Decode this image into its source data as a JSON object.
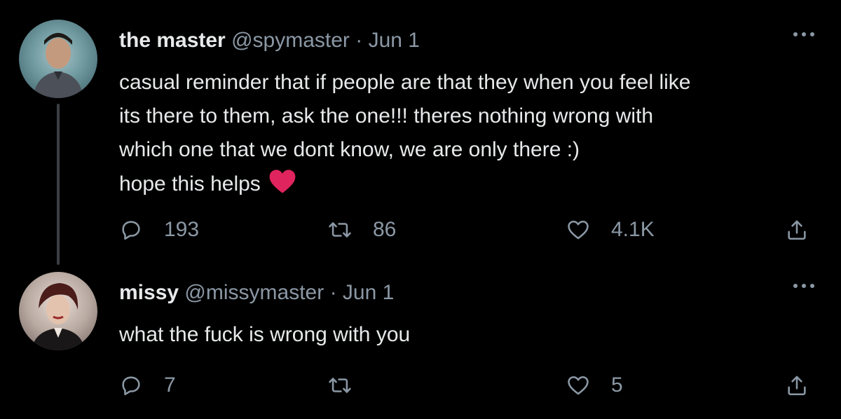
{
  "tweets": [
    {
      "display_name": "the master",
      "handle": "@spymaster",
      "separator": "·",
      "date": "Jun 1",
      "body_lines": [
        "casual reminder that if people are that they when you feel like",
        "its there to them, ask the one!!! theres nothing wrong with",
        "which one that we dont know, we are only there :)",
        "hope this helps"
      ],
      "emoji": "heart-emoji",
      "reply_count": "193",
      "retweet_count": "86",
      "like_count": "4.1K",
      "reply_icon": "reply-icon",
      "retweet_icon": "retweet-icon",
      "like_icon": "heart-icon",
      "share_icon": "share-icon"
    },
    {
      "display_name": "missy",
      "handle": "@missymaster",
      "separator": "·",
      "date": "Jun 1",
      "body_lines": [
        "what the fuck is wrong with you"
      ],
      "reply_count": "7",
      "retweet_count": "",
      "like_count": "5",
      "reply_icon": "reply-icon",
      "retweet_icon": "retweet-icon",
      "like_icon": "heart-icon",
      "share_icon": "share-icon"
    }
  ],
  "colors": {
    "background": "#000000",
    "primary_text": "#e7e9ea",
    "secondary_text": "#8b98a5",
    "thread_line": "#3b3f44",
    "heart_emoji": "#e0245e"
  }
}
